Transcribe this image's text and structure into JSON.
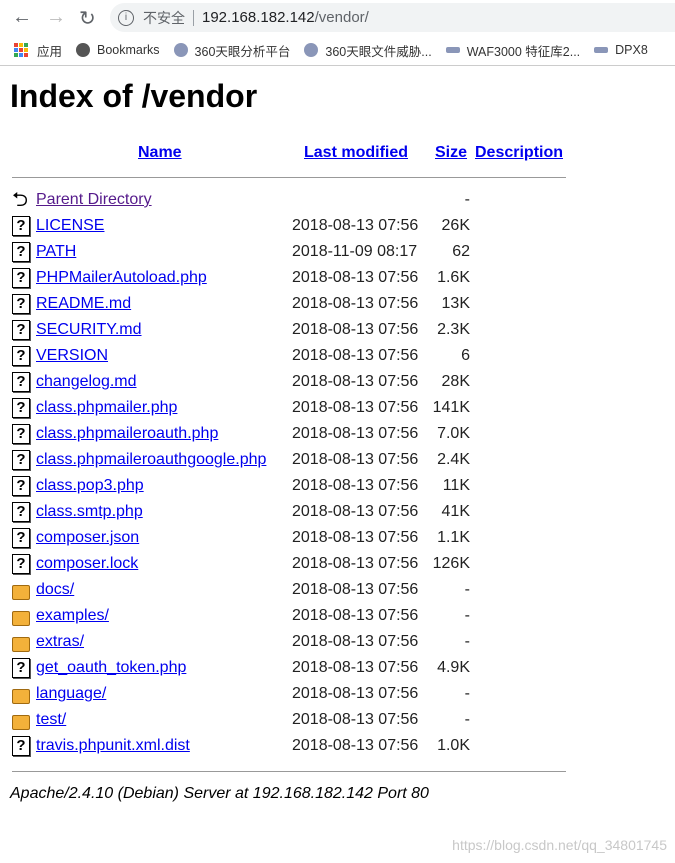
{
  "browser": {
    "security_label": "不安全",
    "url_host": "192.168.182.142",
    "url_path": "/vendor/",
    "bookmarks": [
      "应用",
      "Bookmarks",
      "360天眼分析平台",
      "360天眼文件威胁...",
      "WAF3000 特征库2...",
      "DPX8"
    ]
  },
  "page": {
    "title": "Index of /vendor",
    "headers": {
      "name": "Name",
      "modified": "Last modified",
      "size": "Size",
      "description": "Description"
    },
    "rows": [
      {
        "icon": "back-icon",
        "name": "Parent Directory",
        "date": "",
        "size": "-"
      },
      {
        "icon": "unknown-file-icon",
        "name": "LICENSE",
        "date": "2018-08-13 07:56",
        "size": "26K"
      },
      {
        "icon": "unknown-file-icon",
        "name": "PATH",
        "date": "2018-11-09 08:17",
        "size": "62"
      },
      {
        "icon": "unknown-file-icon",
        "name": "PHPMailerAutoload.php",
        "date": "2018-08-13 07:56",
        "size": "1.6K"
      },
      {
        "icon": "unknown-file-icon",
        "name": "README.md",
        "date": "2018-08-13 07:56",
        "size": "13K"
      },
      {
        "icon": "unknown-file-icon",
        "name": "SECURITY.md",
        "date": "2018-08-13 07:56",
        "size": "2.3K"
      },
      {
        "icon": "unknown-file-icon",
        "name": "VERSION",
        "date": "2018-08-13 07:56",
        "size": "6"
      },
      {
        "icon": "unknown-file-icon",
        "name": "changelog.md",
        "date": "2018-08-13 07:56",
        "size": "28K"
      },
      {
        "icon": "unknown-file-icon",
        "name": "class.phpmailer.php",
        "date": "2018-08-13 07:56",
        "size": "141K"
      },
      {
        "icon": "unknown-file-icon",
        "name": "class.phpmaileroauth.php",
        "date": "2018-08-13 07:56",
        "size": "7.0K"
      },
      {
        "icon": "unknown-file-icon",
        "name": "class.phpmaileroauthgoogle.php",
        "date": "2018-08-13 07:56",
        "size": "2.4K"
      },
      {
        "icon": "unknown-file-icon",
        "name": "class.pop3.php",
        "date": "2018-08-13 07:56",
        "size": "11K"
      },
      {
        "icon": "unknown-file-icon",
        "name": "class.smtp.php",
        "date": "2018-08-13 07:56",
        "size": "41K"
      },
      {
        "icon": "unknown-file-icon",
        "name": "composer.json",
        "date": "2018-08-13 07:56",
        "size": "1.1K"
      },
      {
        "icon": "unknown-file-icon",
        "name": "composer.lock",
        "date": "2018-08-13 07:56",
        "size": "126K"
      },
      {
        "icon": "folder-icon",
        "name": "docs/",
        "date": "2018-08-13 07:56",
        "size": "-"
      },
      {
        "icon": "folder-icon",
        "name": "examples/",
        "date": "2018-08-13 07:56",
        "size": "-"
      },
      {
        "icon": "folder-icon",
        "name": "extras/",
        "date": "2018-08-13 07:56",
        "size": "-"
      },
      {
        "icon": "unknown-file-icon",
        "name": "get_oauth_token.php",
        "date": "2018-08-13 07:56",
        "size": "4.9K"
      },
      {
        "icon": "folder-icon",
        "name": "language/",
        "date": "2018-08-13 07:56",
        "size": "-"
      },
      {
        "icon": "folder-icon",
        "name": "test/",
        "date": "2018-08-13 07:56",
        "size": "-"
      },
      {
        "icon": "unknown-file-icon",
        "name": "travis.phpunit.xml.dist",
        "date": "2018-08-13 07:56",
        "size": "1.0K"
      }
    ],
    "address": "Apache/2.4.10 (Debian) Server at 192.168.182.142 Port 80"
  },
  "watermark": "https://blog.csdn.net/qq_34801745",
  "colors": {
    "link": "#0000ee",
    "visited": "#551a8b"
  }
}
